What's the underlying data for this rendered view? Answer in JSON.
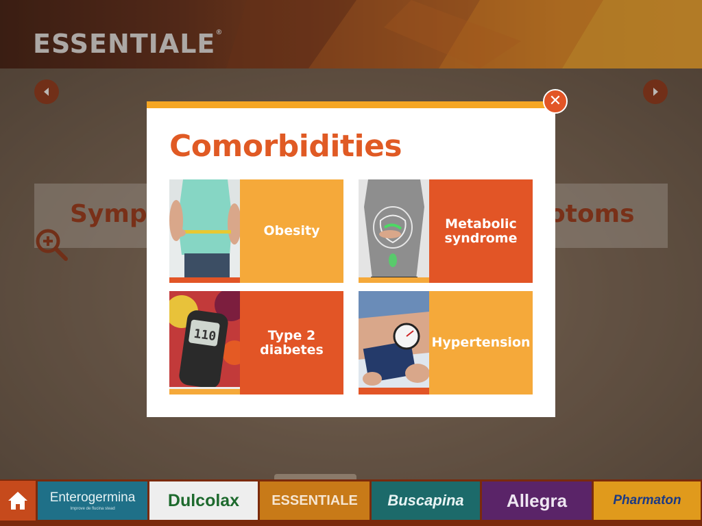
{
  "header": {
    "brand": "ESSENTIALE",
    "brand_mark": "®"
  },
  "background": {
    "heading_left": "Sympt",
    "heading_right": "otoms"
  },
  "modal": {
    "title": "Comorbidities",
    "close_glyph": "✕",
    "tiles": [
      {
        "label": "Obesity",
        "panel_color": "#f5a93a",
        "strip_color": "#e25526"
      },
      {
        "label_line1": "Metabolic",
        "label_line2": "syndrome",
        "panel_color": "#e25526",
        "strip_color": "#f5a93a"
      },
      {
        "label_line1": "Type 2",
        "label_line2": "diabetes",
        "panel_color": "#e25526",
        "strip_color": "#f5a93a"
      },
      {
        "label": "Hypertension",
        "panel_color": "#f5a93a",
        "strip_color": "#e25526"
      }
    ]
  },
  "product_bar": {
    "home_icon": "home-icon",
    "products": [
      {
        "name": "Enterogermina",
        "tagline": "Improve de flucina stead"
      },
      {
        "name": "Dulcolax"
      },
      {
        "name": "ESSENTIALE"
      },
      {
        "name": "Buscapina"
      },
      {
        "name": "Allegra"
      },
      {
        "name": "Pharmaton"
      }
    ]
  },
  "colors": {
    "accent_orange": "#e25526",
    "accent_yellow": "#f5a623"
  }
}
